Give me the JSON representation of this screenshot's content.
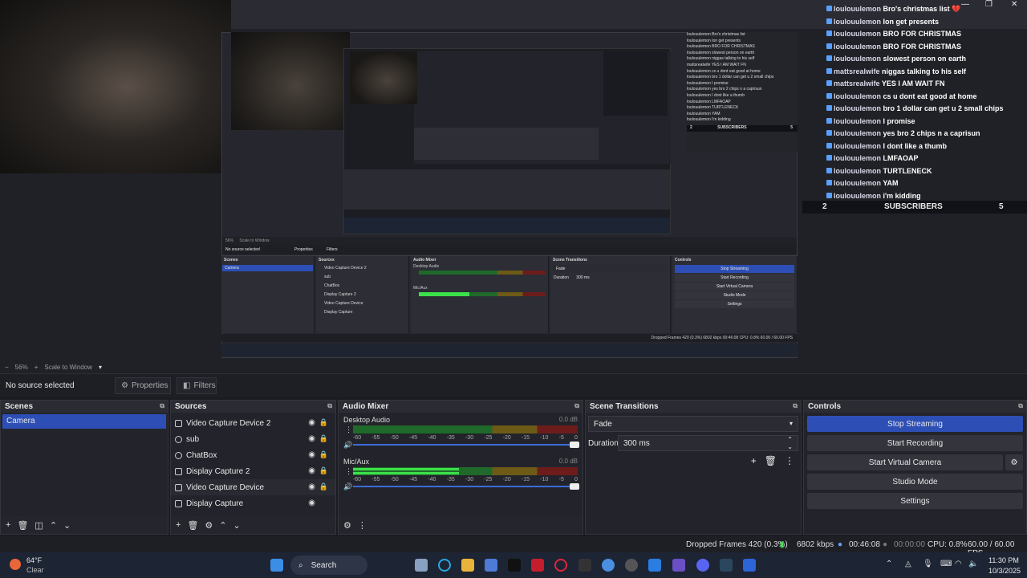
{
  "preview": {
    "nested": {
      "scene_label": "Camera",
      "no_source": "No source selected",
      "properties": "Properties",
      "filters": "Filters",
      "scenes_title": "Scenes",
      "sources_title": "Sources",
      "mixer_title": "Audio Mixer",
      "transitions_title": "Scene Transitions",
      "controls_title": "Controls",
      "sources": [
        "Video Capture Device 2",
        "sub",
        "ChatBox",
        "Display Capture 2",
        "Video Capture Device",
        "Display Capture"
      ],
      "mixer": [
        "Desktop Audio",
        "Mic/Aux"
      ],
      "fade": "Fade",
      "duration": "Duration",
      "duration_val": "300 ms",
      "controls": [
        "Stop Streaming",
        "Start Recording",
        "Start Virtual Camera",
        "Studio Mode",
        "Settings"
      ],
      "status": "Dropped Frames 420 (0.3%)   6802 kbps   00:46:08   CPU: 0.8%   60.00 / 60.00 FPS",
      "zoom": "56%",
      "zoom_mode": "Scale to Window",
      "chat_lines": [
        "loulouulemon Bro's christmas list",
        "loulouulemon Ion get presents",
        "loulouulemon BRO FOR CHRISTMAS",
        "loulouulemon slowest person on earth",
        "loulouulemon niggas talking to his self",
        "mattsrealwife YES I AM WAIT FN",
        "loulouulemon cs u dont eat good at home",
        "loulouulemon bro 1 dollar can get u 2 small chips",
        "loulouulemon I promise",
        "loulouulemon yes bro 2 chips n a caprisun",
        "loulouulemon I dont like a thumb",
        "loulouulemon LMFAOAP",
        "loulouulemon TURTLENECK",
        "loulouulemon YAM",
        "loulouulemon i'm kidding"
      ],
      "subs_left": "2",
      "subs_label": "SUBSCRIBERS",
      "subs_right": "5"
    },
    "chat": [
      {
        "user": "loulouulemon",
        "msg": "Bro's christmas list 💔"
      },
      {
        "user": "loulouulemon",
        "msg": "Ion get presents"
      },
      {
        "user": "loulouulemon",
        "msg": "BRO FOR CHRISTMAS"
      },
      {
        "user": "loulouulemon",
        "msg": "BRO FOR CHRISTMAS"
      },
      {
        "user": "loulouulemon",
        "msg": "slowest person on earth"
      },
      {
        "user": "mattsrealwife",
        "msg": "niggas talking to his self"
      },
      {
        "user": "mattsrealwife",
        "msg": "YES I AM WAIT FN"
      },
      {
        "user": "loulouulemon",
        "msg": "cs u dont eat good at home"
      },
      {
        "user": "loulouulemon",
        "msg": "bro 1 dollar can get u 2 small chips"
      },
      {
        "user": "loulouulemon",
        "msg": "I promise"
      },
      {
        "user": "loulouulemon",
        "msg": "yes bro 2 chips n a caprisun"
      },
      {
        "user": "loulouulemon",
        "msg": "I dont like a thumb"
      },
      {
        "user": "loulouulemon",
        "msg": "LMFAOAP"
      },
      {
        "user": "loulouulemon",
        "msg": "TURTLENECK"
      },
      {
        "user": "loulouulemon",
        "msg": "YAM"
      },
      {
        "user": "loulouulemon",
        "msg": "i'm kidding"
      }
    ],
    "subs": {
      "left": "2",
      "label": "SUBSCRIBERS",
      "right": "5"
    }
  },
  "zoombar": {
    "zoom": "56%",
    "mode": "Scale to Window"
  },
  "propbar": {
    "no_source": "No source selected",
    "properties": "Properties",
    "filters": "Filters"
  },
  "scenes": {
    "title": "Scenes",
    "items": [
      "Camera"
    ]
  },
  "sources": {
    "title": "Sources",
    "items": [
      "Video Capture Device 2",
      "sub",
      "ChatBox",
      "Display Capture 2",
      "Video Capture Device",
      "Display Capture"
    ]
  },
  "mixer": {
    "title": "Audio Mixer",
    "channels": [
      {
        "name": "Desktop Audio",
        "db": "0.0 dB",
        "level": 0.0
      },
      {
        "name": "Mic/Aux",
        "db": "0.0 dB",
        "level": 0.47
      }
    ],
    "scale": [
      "-60",
      "-55",
      "-50",
      "-45",
      "-40",
      "-35",
      "-30",
      "-25",
      "-20",
      "-15",
      "-10",
      "-5",
      "0"
    ]
  },
  "transitions": {
    "title": "Scene Transitions",
    "type": "Fade",
    "duration_label": "Duration",
    "duration": "300 ms"
  },
  "controls": {
    "title": "Controls",
    "stop_streaming": "Stop Streaming",
    "start_recording": "Start Recording",
    "start_virtual_camera": "Start Virtual Camera",
    "studio_mode": "Studio Mode",
    "settings": "Settings"
  },
  "status": {
    "dropped": "Dropped Frames 420 (0.3%)",
    "kbps": "6802 kbps",
    "stream_time": "00:46:08",
    "rec_time": "00:00:00",
    "cpu": "CPU: 0.8%",
    "fps": "60.00 / 60.00 FPS"
  },
  "taskbar": {
    "temp": "64°F",
    "weather": "Clear",
    "search": "Search",
    "time": "11:30 PM",
    "date": "10/3/2025"
  },
  "colors": {
    "accent": "#2d4fb5",
    "meter_green": "#3ce04a"
  }
}
